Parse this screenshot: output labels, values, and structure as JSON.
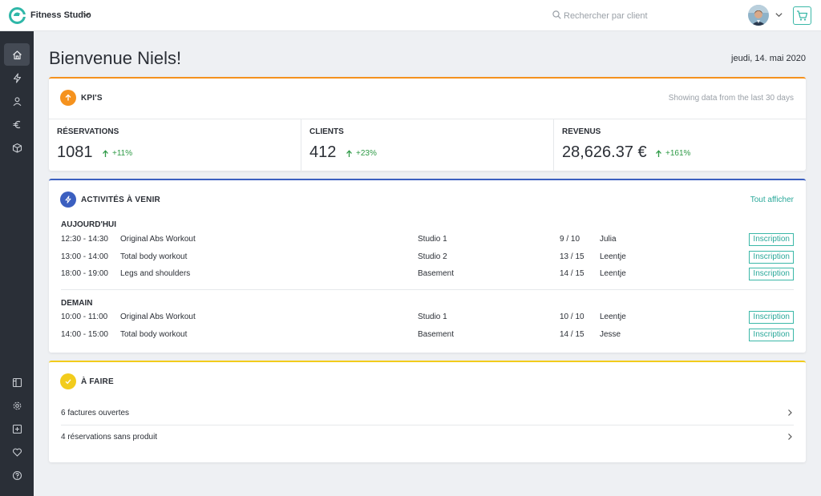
{
  "header": {
    "studio_name": "Fitness Studio",
    "search_placeholder": "Rechercher par client"
  },
  "main": {
    "greeting": "Bienvenue Niels!",
    "date": "jeudi, 14. mai 2020"
  },
  "kpis": {
    "title": "KPI'S",
    "note": "Showing data from the last 30 days",
    "items": [
      {
        "label": "RÉSERVATIONS",
        "value": "1081",
        "change": "+11%"
      },
      {
        "label": "CLIENTS",
        "value": "412",
        "change": "+23%"
      },
      {
        "label": "REVENUS",
        "value": "28,626.37 €",
        "change": "+161%"
      }
    ]
  },
  "activities": {
    "title": "ACTIVITÉS À VENIR",
    "show_all": "Tout afficher",
    "button_label": "Inscription",
    "groups": [
      {
        "label": "AUJOURD'HUI",
        "rows": [
          {
            "time": "12:30 - 14:30",
            "name": "Original Abs Workout",
            "room": "Studio 1",
            "capacity": "9 / 10",
            "coach": "Julia"
          },
          {
            "time": "13:00 - 14:00",
            "name": "Total body workout",
            "room": "Studio 2",
            "capacity": "13 / 15",
            "coach": "Leentje"
          },
          {
            "time": "18:00 - 19:00",
            "name": "Legs and shoulders",
            "room": "Basement",
            "capacity": "14 / 15",
            "coach": "Leentje"
          }
        ]
      },
      {
        "label": "DEMAIN",
        "rows": [
          {
            "time": "10:00 - 11:00",
            "name": "Original Abs Workout",
            "room": "Studio 1",
            "capacity": "10 / 10",
            "coach": "Leentje"
          },
          {
            "time": "14:00 - 15:00",
            "name": "Total body workout",
            "room": "Basement",
            "capacity": "14 / 15",
            "coach": "Jesse"
          }
        ]
      }
    ]
  },
  "todo": {
    "title": "À FAIRE",
    "items": [
      {
        "text": "6  factures ouvertes"
      },
      {
        "text": "4 réservations sans produit"
      }
    ]
  },
  "colors": {
    "accent": "#3bb8a8",
    "sidebar": "#2a2f37",
    "kpi_icon": "#f5921e",
    "activities_icon": "#3b5fc0",
    "todo_icon": "#f2cc1c",
    "positive": "#2e9a46"
  },
  "icons": {
    "sidebar_top": [
      "home-icon",
      "lightning-icon",
      "user-icon",
      "euro-icon",
      "box-icon"
    ],
    "sidebar_bottom": [
      "layout-icon",
      "gear-icon",
      "plus-square-icon",
      "heart-icon",
      "help-icon"
    ]
  }
}
